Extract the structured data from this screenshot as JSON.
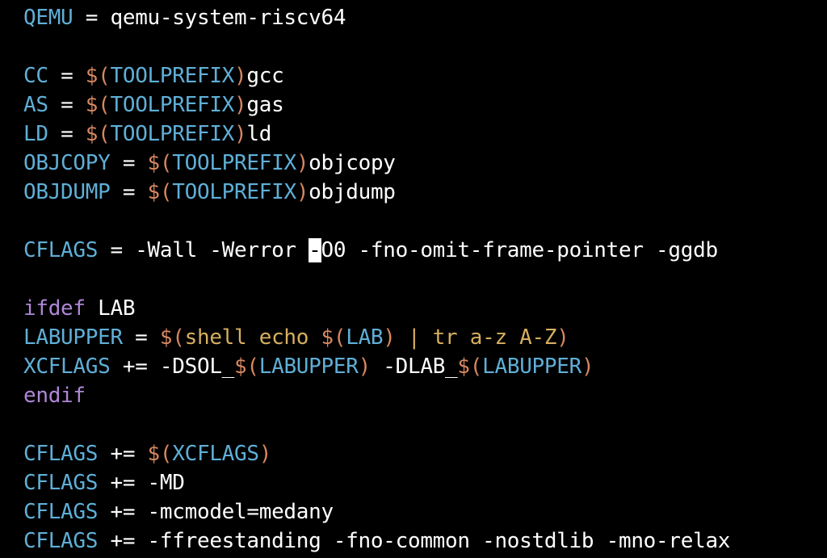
{
  "lines": [
    [
      {
        "c": "var",
        "t": "QEMU"
      },
      {
        "c": "op",
        "t": " = "
      },
      {
        "c": "txt",
        "t": "qemu-system-riscv64"
      }
    ],
    [],
    [
      {
        "c": "var",
        "t": "CC"
      },
      {
        "c": "op",
        "t": " = "
      },
      {
        "c": "dol",
        "t": "$("
      },
      {
        "c": "var",
        "t": "TOOLPREFIX"
      },
      {
        "c": "dol",
        "t": ")"
      },
      {
        "c": "txt",
        "t": "gcc"
      }
    ],
    [
      {
        "c": "var",
        "t": "AS"
      },
      {
        "c": "op",
        "t": " = "
      },
      {
        "c": "dol",
        "t": "$("
      },
      {
        "c": "var",
        "t": "TOOLPREFIX"
      },
      {
        "c": "dol",
        "t": ")"
      },
      {
        "c": "txt",
        "t": "gas"
      }
    ],
    [
      {
        "c": "var",
        "t": "LD"
      },
      {
        "c": "op",
        "t": " = "
      },
      {
        "c": "dol",
        "t": "$("
      },
      {
        "c": "var",
        "t": "TOOLPREFIX"
      },
      {
        "c": "dol",
        "t": ")"
      },
      {
        "c": "txt",
        "t": "ld"
      }
    ],
    [
      {
        "c": "var",
        "t": "OBJCOPY"
      },
      {
        "c": "op",
        "t": " = "
      },
      {
        "c": "dol",
        "t": "$("
      },
      {
        "c": "var",
        "t": "TOOLPREFIX"
      },
      {
        "c": "dol",
        "t": ")"
      },
      {
        "c": "txt",
        "t": "objcopy"
      }
    ],
    [
      {
        "c": "var",
        "t": "OBJDUMP"
      },
      {
        "c": "op",
        "t": " = "
      },
      {
        "c": "dol",
        "t": "$("
      },
      {
        "c": "var",
        "t": "TOOLPREFIX"
      },
      {
        "c": "dol",
        "t": ")"
      },
      {
        "c": "txt",
        "t": "objdump"
      }
    ],
    [],
    [
      {
        "c": "var",
        "t": "CFLAGS"
      },
      {
        "c": "op",
        "t": " = "
      },
      {
        "c": "txt",
        "t": "-Wall -Werror "
      },
      {
        "c": "cursor",
        "t": "-"
      },
      {
        "c": "txt",
        "t": "O0 -fno-omit-frame-pointer -ggdb"
      }
    ],
    [],
    [
      {
        "c": "kw",
        "t": "ifdef"
      },
      {
        "c": "txt",
        "t": " LAB"
      }
    ],
    [
      {
        "c": "var",
        "t": "LABUPPER"
      },
      {
        "c": "op",
        "t": " = "
      },
      {
        "c": "dol",
        "t": "$("
      },
      {
        "c": "cmd",
        "t": "shell echo "
      },
      {
        "c": "dol",
        "t": "$("
      },
      {
        "c": "var",
        "t": "LAB"
      },
      {
        "c": "dol",
        "t": ")"
      },
      {
        "c": "cmd",
        "t": " | tr a-z A-Z"
      },
      {
        "c": "dol",
        "t": ")"
      }
    ],
    [
      {
        "c": "var",
        "t": "XCFLAGS"
      },
      {
        "c": "op",
        "t": " += "
      },
      {
        "c": "txt",
        "t": "-DSOL_"
      },
      {
        "c": "dol",
        "t": "$("
      },
      {
        "c": "var",
        "t": "LABUPPER"
      },
      {
        "c": "dol",
        "t": ")"
      },
      {
        "c": "txt",
        "t": " -DLAB_"
      },
      {
        "c": "dol",
        "t": "$("
      },
      {
        "c": "var",
        "t": "LABUPPER"
      },
      {
        "c": "dol",
        "t": ")"
      }
    ],
    [
      {
        "c": "kw",
        "t": "endif"
      }
    ],
    [],
    [
      {
        "c": "var",
        "t": "CFLAGS"
      },
      {
        "c": "op",
        "t": " += "
      },
      {
        "c": "dol",
        "t": "$("
      },
      {
        "c": "var",
        "t": "XCFLAGS"
      },
      {
        "c": "dol",
        "t": ")"
      }
    ],
    [
      {
        "c": "var",
        "t": "CFLAGS"
      },
      {
        "c": "op",
        "t": " += "
      },
      {
        "c": "txt",
        "t": "-MD"
      }
    ],
    [
      {
        "c": "var",
        "t": "CFLAGS"
      },
      {
        "c": "op",
        "t": " += "
      },
      {
        "c": "txt",
        "t": "-mcmodel=medany"
      }
    ],
    [
      {
        "c": "var",
        "t": "CFLAGS"
      },
      {
        "c": "op",
        "t": " += "
      },
      {
        "c": "txt",
        "t": "-ffreestanding -fno-common -nostdlib -mno-relax"
      }
    ]
  ]
}
